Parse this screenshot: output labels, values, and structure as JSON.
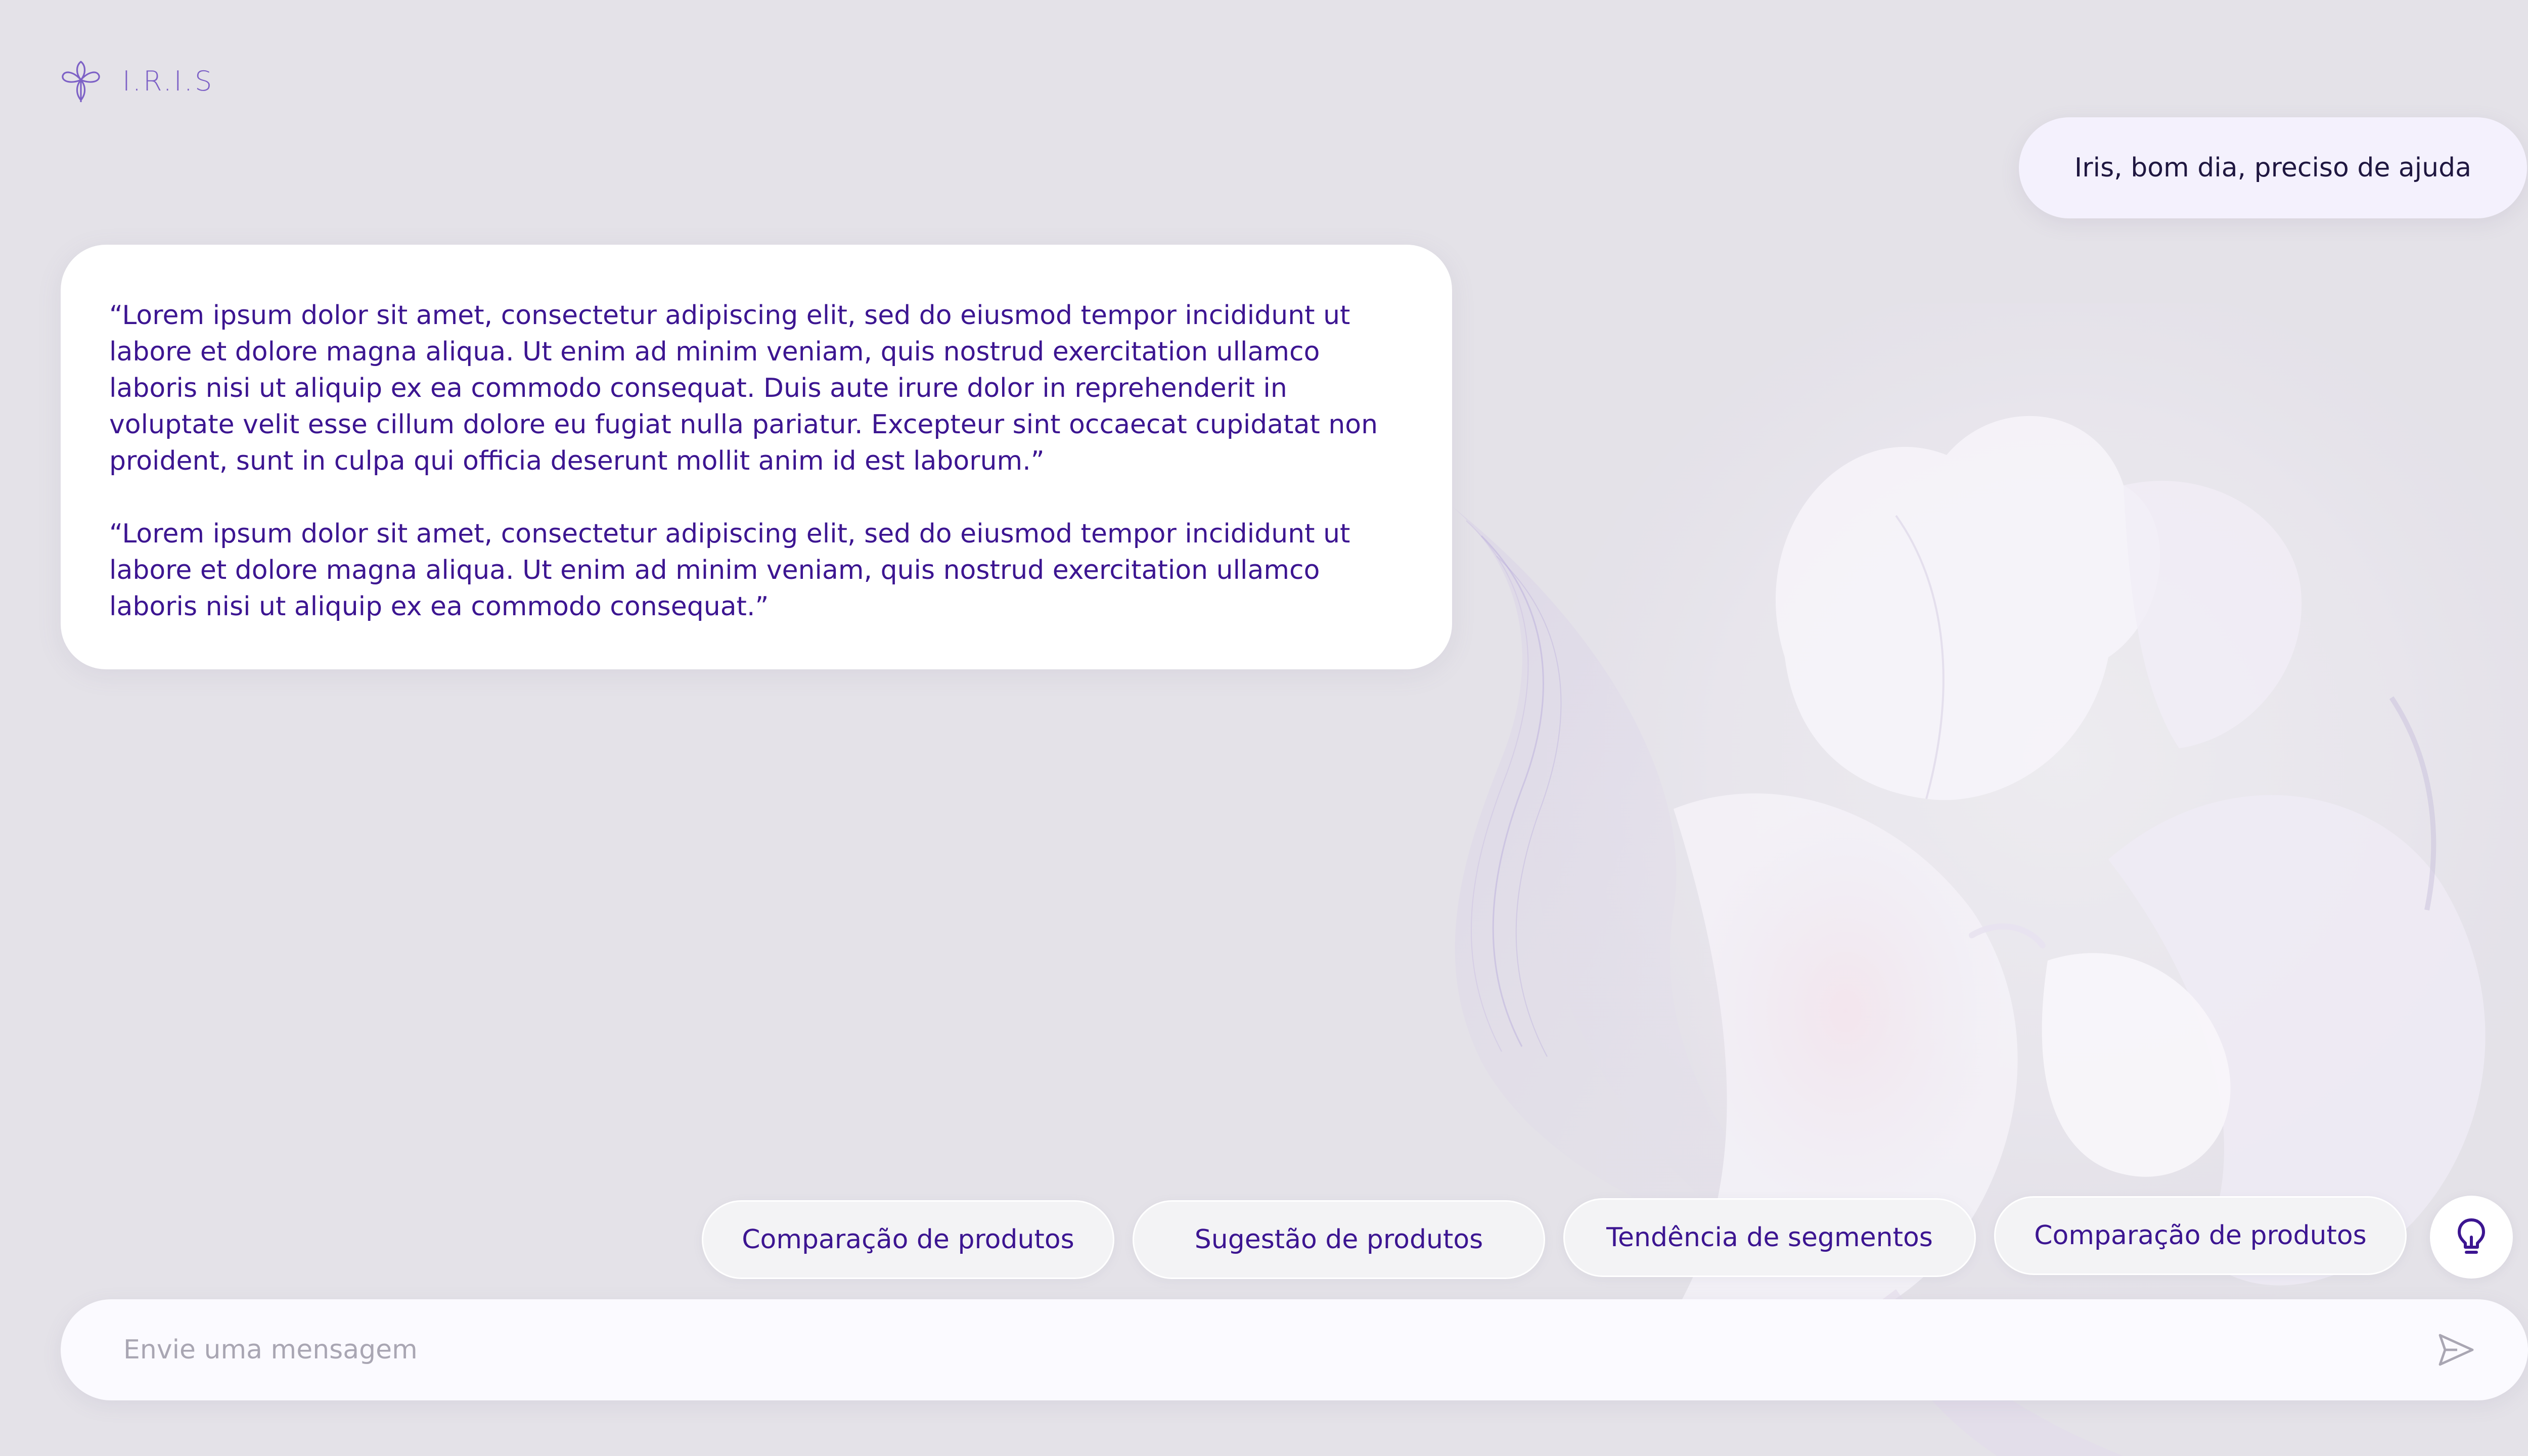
{
  "app": {
    "name": "I.R.I.S",
    "logo_icon": "iris-flower-icon"
  },
  "conversation": {
    "user_message": "Iris, bom dia, preciso de ajuda",
    "assistant_paragraphs": [
      "“Lorem ipsum dolor sit amet, consectetur adipiscing elit, sed do eiusmod tempor incididunt ut labore et dolore magna aliqua. Ut enim ad minim veniam, quis nostrud exercitation ullamco laboris nisi ut aliquip ex ea commodo consequat. Duis aute irure dolor in reprehenderit in voluptate velit esse cillum dolore eu fugiat nulla pariatur. Excepteur sint occaecat cupidatat non proident, sunt in culpa qui officia deserunt mollit anim id est laborum.”",
      "“Lorem ipsum dolor sit amet, consectetur adipiscing elit, sed do eiusmod tempor incididunt ut labore et dolore magna aliqua. Ut enim ad minim veniam, quis nostrud exercitation ullamco laboris nisi ut aliquip ex ea commodo consequat.”"
    ]
  },
  "suggestions": [
    "Comparação de produtos",
    "Sugestão de produtos",
    "Tendência de segmentos",
    "Comparação de produtos"
  ],
  "suggestion_toggle_icon": "lightbulb-icon",
  "composer": {
    "placeholder": "Envie uma mensagem",
    "value": "",
    "send_icon": "send-icon"
  },
  "colors": {
    "background": "#e4e2e8",
    "accent_text": "#3c1591",
    "logo": "#7d61c6",
    "user_bubble": "#f4f1fd",
    "assistant_bubble": "#ffffff",
    "placeholder": "#a9a6b3"
  }
}
